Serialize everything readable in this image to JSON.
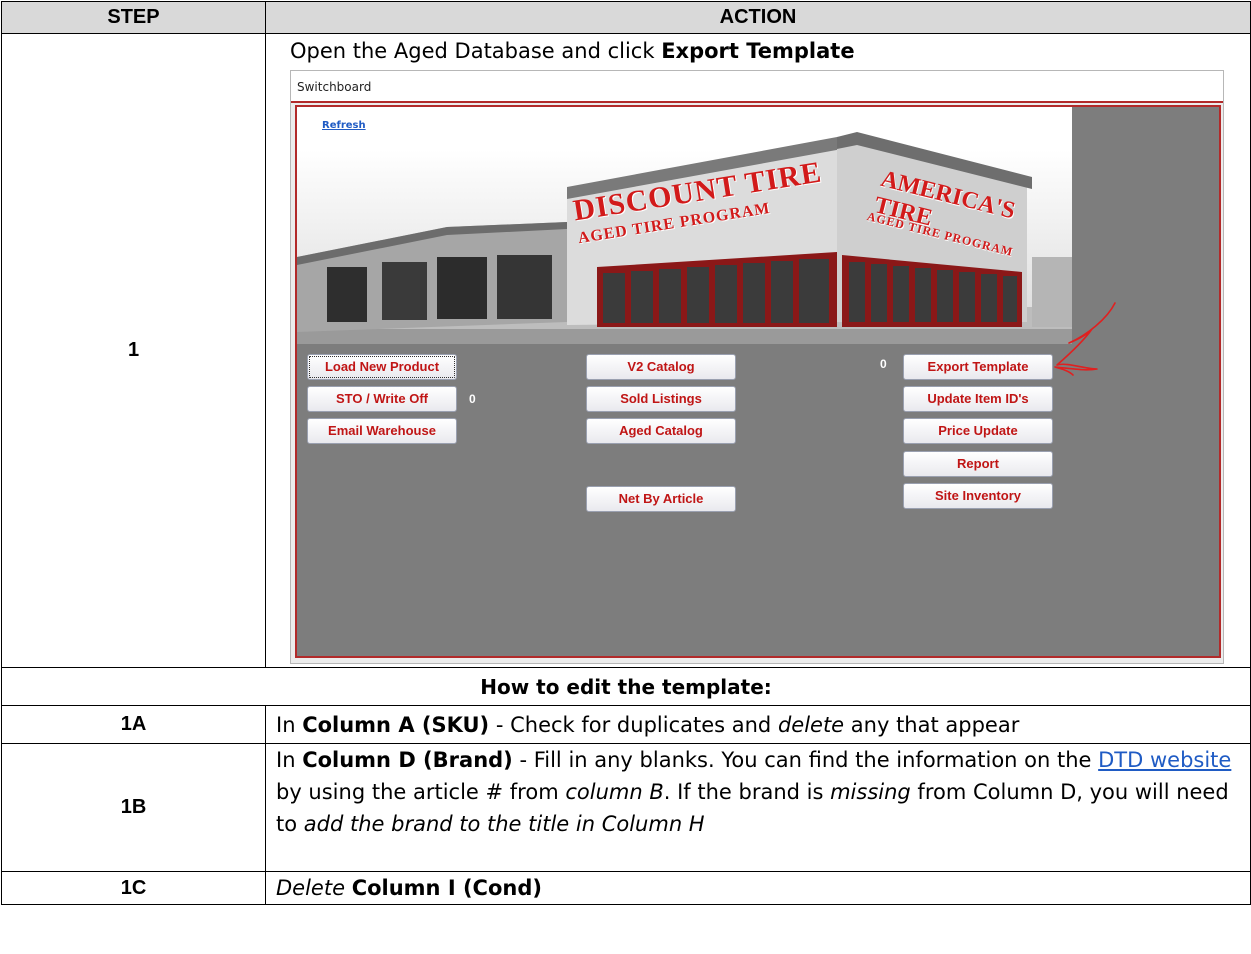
{
  "table": {
    "header_step": "STEP",
    "header_action": "ACTION"
  },
  "row1": {
    "step": "1",
    "text_before": "Open the Aged Database and click ",
    "text_bold": "Export Template"
  },
  "switchboard": {
    "window_title": "Switchboard",
    "refresh_link": "Refresh",
    "banner_left": "DISCOUNT TIRE",
    "banner_left_sub": "AGED TIRE PROGRAM",
    "banner_right": "AMERICA'S TIRE",
    "banner_right_sub": "AGED TIRE PROGRAM",
    "buttons": {
      "load_new_product": "Load New Product",
      "sto_write_off": "STO / Write Off",
      "email_warehouse": "Email Warehouse",
      "v2_catalog": "V2 Catalog",
      "sold_listings": "Sold Listings",
      "aged_catalog": "Aged Catalog",
      "net_by_article": "Net By Article",
      "export_template": "Export Template",
      "update_item_ids": "Update Item ID's",
      "price_update": "Price Update",
      "report": "Report",
      "site_inventory": "Site Inventory"
    },
    "counter_sto": "0",
    "counter_export": "0",
    "annotation_color": "#e02020"
  },
  "section": {
    "edit_heading": "How to edit the template:"
  },
  "row1a": {
    "step": "1A",
    "p1": "In ",
    "b1": "Column A (SKU)",
    "p2": " - Check for duplicates and ",
    "i1": "delete",
    "p3": " any that appear"
  },
  "row1b": {
    "step": "1B",
    "p1": "In ",
    "b1": "Column D (Brand)",
    "p2": " - Fill in any blanks. You can find the information on the ",
    "link": "DTD website",
    "p3": " by using the article # from ",
    "i1": "column B",
    "p4": ". If the brand is ",
    "i2": "missing",
    "p5": " from Column D, you will need to ",
    "i3": "add the brand to the title in Column H"
  },
  "row1c": {
    "step": "1C",
    "i1": "Delete",
    "p1": " ",
    "b1": "Column I (Cond)"
  }
}
